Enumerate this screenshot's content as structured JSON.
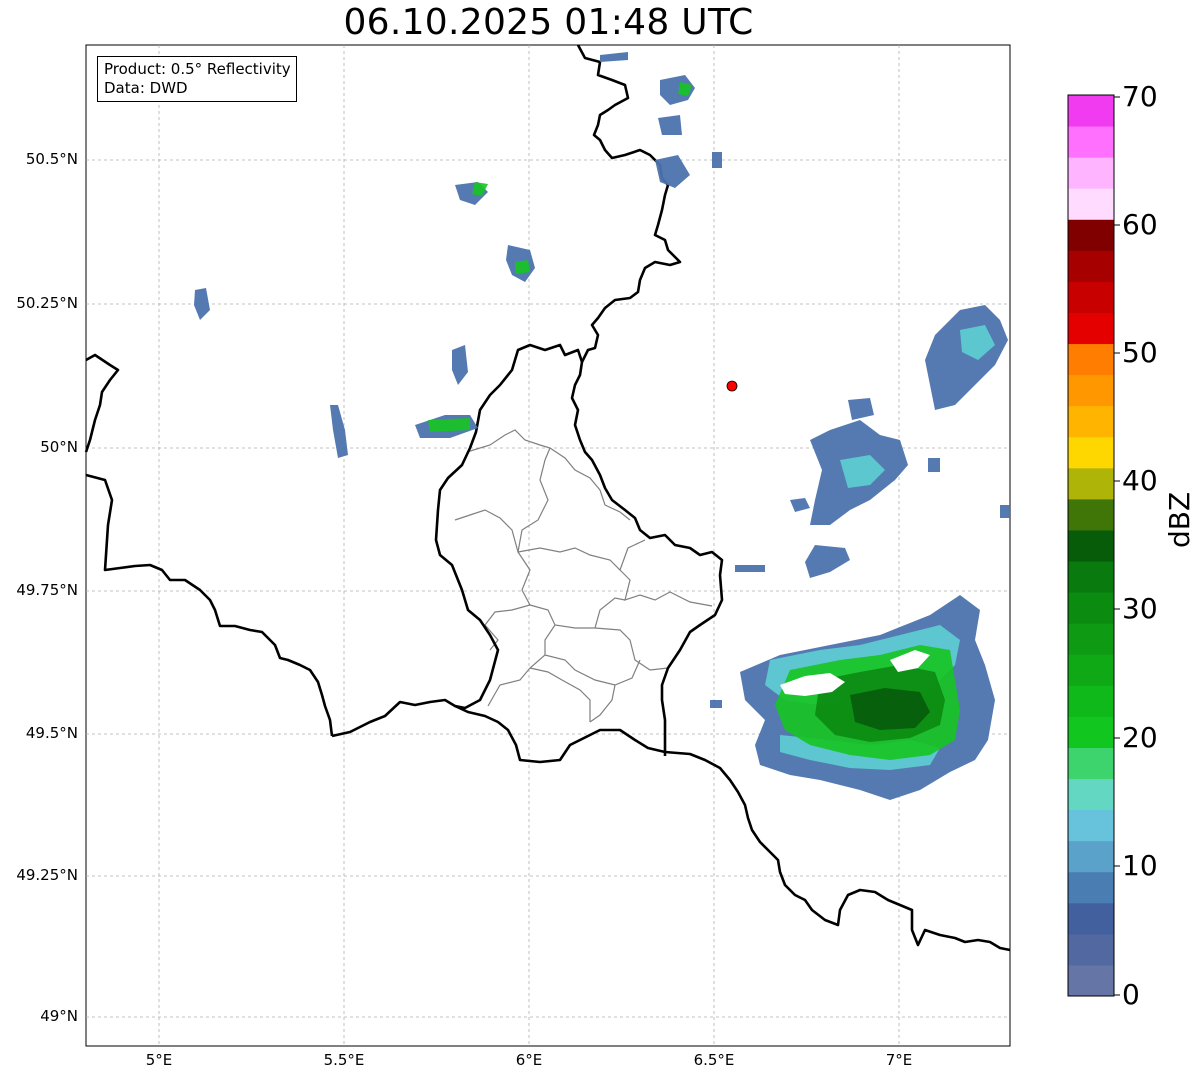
{
  "title": "06.10.2025 01:48 UTC",
  "info": {
    "product": "Product: 0.5° Reflectivity",
    "data": "Data: DWD"
  },
  "axes": {
    "lat_labels": [
      "50.5°N",
      "50.25°N",
      "50°N",
      "49.75°N",
      "49.5°N",
      "49.25°N",
      "49°N"
    ],
    "lon_labels": [
      "5°E",
      "5.5°E",
      "6°E",
      "6.5°E",
      "7°E"
    ]
  },
  "colorbar": {
    "label": "dBZ",
    "ticks": [
      "70",
      "60",
      "50",
      "40",
      "30",
      "20",
      "10",
      "0"
    ],
    "colors": [
      "#6575a6",
      "#5168a1",
      "#42609e",
      "#4a7db2",
      "#5aa2c9",
      "#67c3dc",
      "#63d7c2",
      "#3ed46d",
      "#10c61f",
      "#10b91a",
      "#10a916",
      "#0e9a13",
      "#0b8c11",
      "#097a0d",
      "#075c09",
      "#3f7607",
      "#afb408",
      "#fed600",
      "#ffb500",
      "#ff9800",
      "#ff7d00",
      "#e50000",
      "#c80000",
      "#a70000",
      "#800000",
      "#ffdcff",
      "#ffb4ff",
      "#ff70ff",
      "#f03bf0"
    ]
  },
  "station_marker_color": "#ff0000"
}
